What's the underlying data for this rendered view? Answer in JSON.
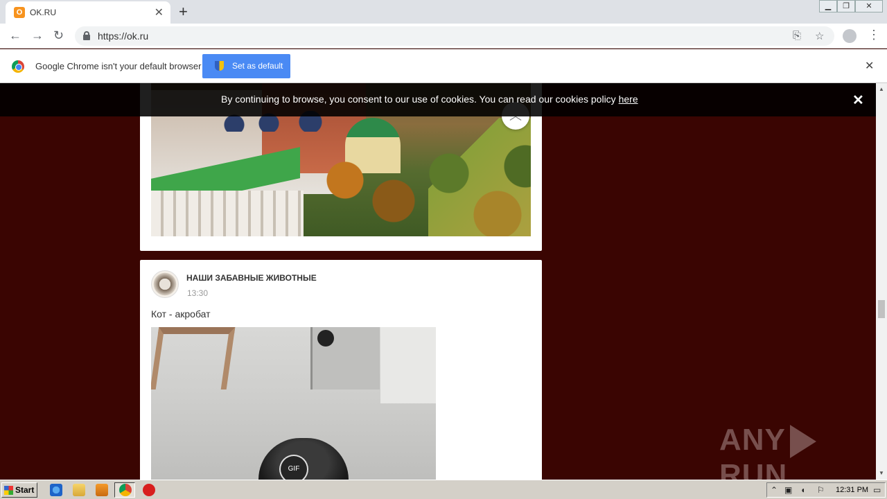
{
  "browser": {
    "tab_title": "OK.RU",
    "tab_favicon": "ok-logo-icon",
    "new_tab_label": "+",
    "url": "https://ok.ru"
  },
  "infobar": {
    "message": "Google Chrome isn't your default browser",
    "button_label": "Set as default"
  },
  "cookie_banner": {
    "text": "By continuing to browse, you consent to our use of cookies. You can read our cookies policy ",
    "link_text": "here"
  },
  "post": {
    "group_name": "НАШИ ЗАБАВНЫЕ ЖИВОТНЫЕ",
    "time": "13:30",
    "text": "Кот - акробат",
    "media_badge": "GIF"
  },
  "watermark": {
    "left": "ANY",
    "right": "RUN"
  },
  "taskbar": {
    "start_label": "Start",
    "clock": "12:31 PM"
  },
  "colors": {
    "page_background": "#3a0502",
    "button_blue": "#4a8af4",
    "tab_bar": "#dee1e6"
  }
}
